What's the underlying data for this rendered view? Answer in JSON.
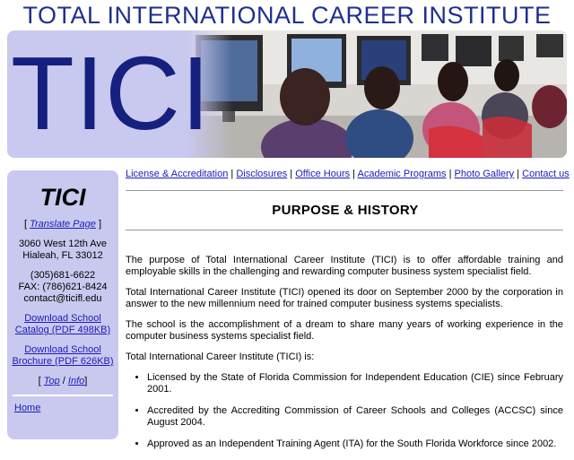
{
  "header": {
    "title": "TOTAL INTERNATIONAL CAREER INSTITUTE"
  },
  "banner": {
    "logo": "TICI"
  },
  "sidebar": {
    "title": "TICI",
    "translate": {
      "open": "[ ",
      "link": "Translate Page",
      "close": " ]"
    },
    "address": [
      "3060 West 12th Ave",
      "Hialeah, FL 33012"
    ],
    "contact": [
      "(305)681-6622",
      "FAX: (786)621-8424",
      "contact@ticifl.edu"
    ],
    "catalog_link": "Download School Catalog (PDF 498KB)",
    "brochure_link": "Download School Brochure (PDF 626KB)",
    "top_info": {
      "open": "[ ",
      "top": "Top",
      "sep": " / ",
      "info": "Info",
      "close": "]"
    },
    "home": "Home"
  },
  "nav": {
    "items": [
      "License & Accreditation",
      "Disclosures",
      "Office Hours",
      "Academic Programs",
      "Photo Gallery",
      "Contact us"
    ],
    "separator": " | "
  },
  "main": {
    "heading": "PURPOSE & HISTORY",
    "paragraphs": [
      "The purpose of Total International Career Institute (TICI) is to offer affordable training and employable skills in the challenging and rewarding computer business system specialist field.",
      "Total International Career Institute (TICI) opened its door on September 2000 by the corporation in answer to the new millennium need for trained computer business systems specialists.",
      "The school is the accomplishment of a dream to share many years of working experience in the computer business systems specialist field.",
      "Total International Career Institute (TICI) is:"
    ],
    "bullets": [
      "Licensed by the State of Florida Commission for Independent Education (CIE) since February 2001.",
      "Accredited by the Accrediting Commission of Career Schools and Colleges (ACCSC) since August 2004.",
      "Approved as an Independent Training Agent (ITA) for the South Florida Workforce since 2002."
    ]
  },
  "colors": {
    "title": "#1f2f8f",
    "panel": "#c9c9ef",
    "link": "#1b1bbd"
  }
}
